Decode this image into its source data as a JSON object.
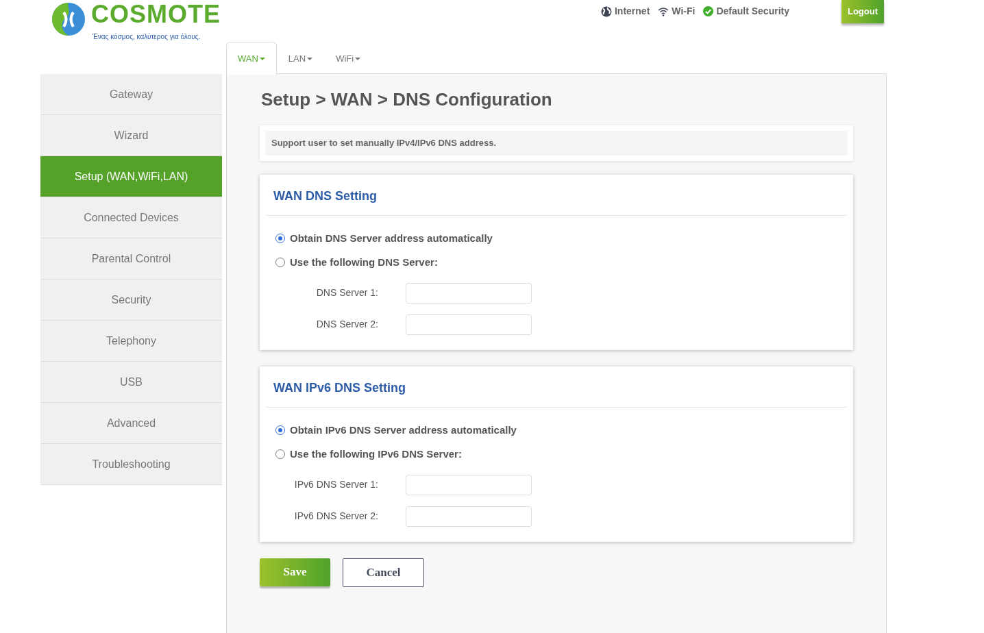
{
  "logo": {
    "wordmark": "COSMOTE",
    "tagline": "Ένας κόσμος, καλύτερος για όλους."
  },
  "status": [
    {
      "kind": "globe",
      "label": "Internet"
    },
    {
      "kind": "wifi",
      "label": "Wi-Fi"
    },
    {
      "kind": "check",
      "label": "Default Security"
    }
  ],
  "logout": "Logout",
  "tabs": [
    {
      "label": "WAN",
      "selected": true
    },
    {
      "label": "LAN",
      "selected": false
    },
    {
      "label": "WiFi",
      "selected": false
    }
  ],
  "sidebar": {
    "items": [
      {
        "label": "Gateway",
        "selected": false
      },
      {
        "label": "Wizard",
        "selected": false
      },
      {
        "label": "Setup (WAN,WiFi,LAN)",
        "selected": true
      },
      {
        "label": "Connected Devices",
        "selected": false
      },
      {
        "label": "Parental Control",
        "selected": false
      },
      {
        "label": "Security",
        "selected": false
      },
      {
        "label": "Telephony",
        "selected": false
      },
      {
        "label": "USB",
        "selected": false
      },
      {
        "label": "Advanced",
        "selected": false
      },
      {
        "label": "Troubleshooting",
        "selected": false
      }
    ]
  },
  "page_title": "Setup > WAN > DNS Configuration",
  "info": "Support user to set manually IPv4/IPv6 DNS address.",
  "sections": [
    {
      "title": "WAN DNS Setting",
      "options": [
        {
          "label": "Obtain DNS Server address automatically",
          "selected": true
        },
        {
          "label": "Use the following DNS Server:",
          "selected": false
        }
      ],
      "fields": [
        {
          "label": "DNS Server 1:"
        },
        {
          "label": "DNS Server 2:"
        }
      ]
    },
    {
      "title": "WAN IPv6 DNS Setting",
      "options": [
        {
          "label": "Obtain IPv6 DNS Server address automatically",
          "selected": true
        },
        {
          "label": "Use the following IPv6 DNS Server:",
          "selected": false
        }
      ],
      "fields": [
        {
          "label": "IPv6 DNS Server 1:"
        },
        {
          "label": "IPv6 DNS Server 2:"
        }
      ]
    }
  ],
  "buttons": {
    "save": "Save",
    "cancel": "Cancel"
  }
}
